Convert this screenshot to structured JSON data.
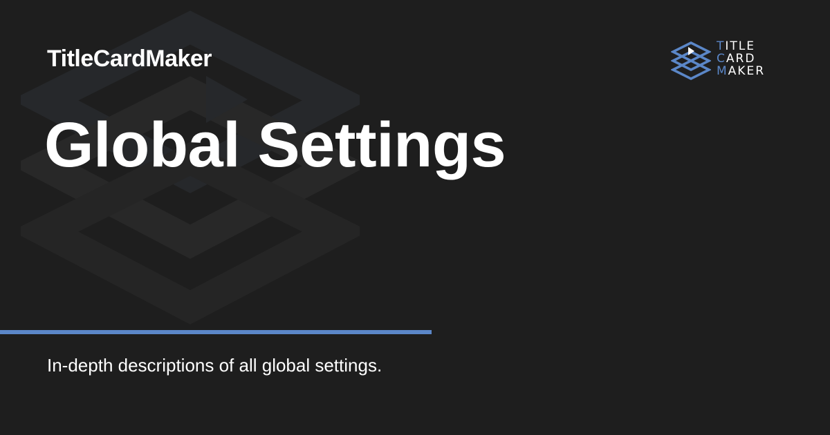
{
  "site_name": "TitleCardMaker",
  "page_title": "Global Settings",
  "description": "In-depth descriptions of all global settings.",
  "brand": {
    "line1": {
      "first": "T",
      "rest": "ITLE"
    },
    "line2": {
      "first": "C",
      "rest": "ARD"
    },
    "line3": {
      "first": "M",
      "rest": "AKER"
    }
  },
  "colors": {
    "background": "#1e1e1e",
    "accent": "#5b87c8",
    "text": "#ffffff",
    "watermark": "#2a2c2f"
  },
  "icons": {
    "background": "stacked-layers-play-icon",
    "brand": "stacked-layers-play-icon"
  }
}
